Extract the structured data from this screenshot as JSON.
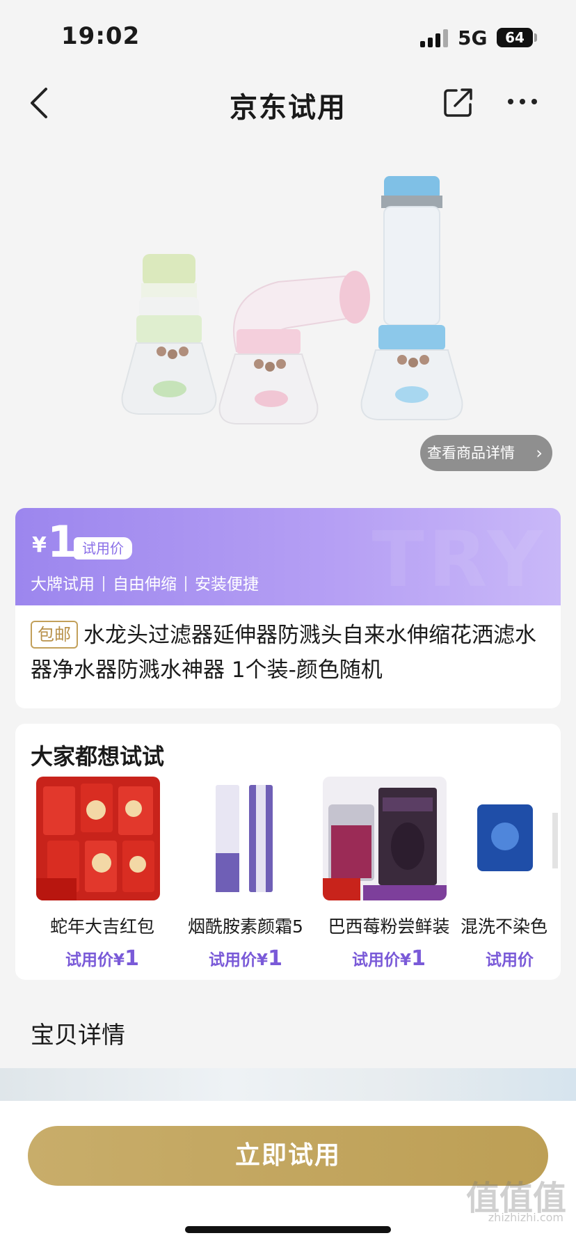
{
  "status_bar": {
    "time": "19:02",
    "network": "5G",
    "battery": "64"
  },
  "nav": {
    "title": "京东试用"
  },
  "hero": {
    "detail_button": "查看商品详情"
  },
  "price_card": {
    "currency": "¥",
    "price": "1",
    "price_tag": "试用价",
    "features": [
      "大牌试用",
      "自由伸缩",
      "安装便捷"
    ],
    "watermark": "TRY",
    "free_shipping": "包邮",
    "product_title": "水龙头过滤器延伸器防溅头自来水伸缩花洒滤水器净水器防溅水神器 1个装-颜色随机"
  },
  "recommendations": {
    "heading": "大家都想试试",
    "items": [
      {
        "name": "蛇年大吉红包",
        "price_label": "试用价¥",
        "price": "1"
      },
      {
        "name": "烟酰胺素颜霜5",
        "price_label": "试用价¥",
        "price": "1"
      },
      {
        "name": "巴西莓粉尝鲜装",
        "price_label": "试用价¥",
        "price": "1"
      },
      {
        "name": "混洗不染色",
        "price_label": "试用价",
        "price": ""
      }
    ]
  },
  "details": {
    "title": "宝贝详情"
  },
  "cta": {
    "label": "立即试用"
  },
  "watermark": {
    "main": "值值值",
    "sub": "zhizhizhi.com"
  }
}
